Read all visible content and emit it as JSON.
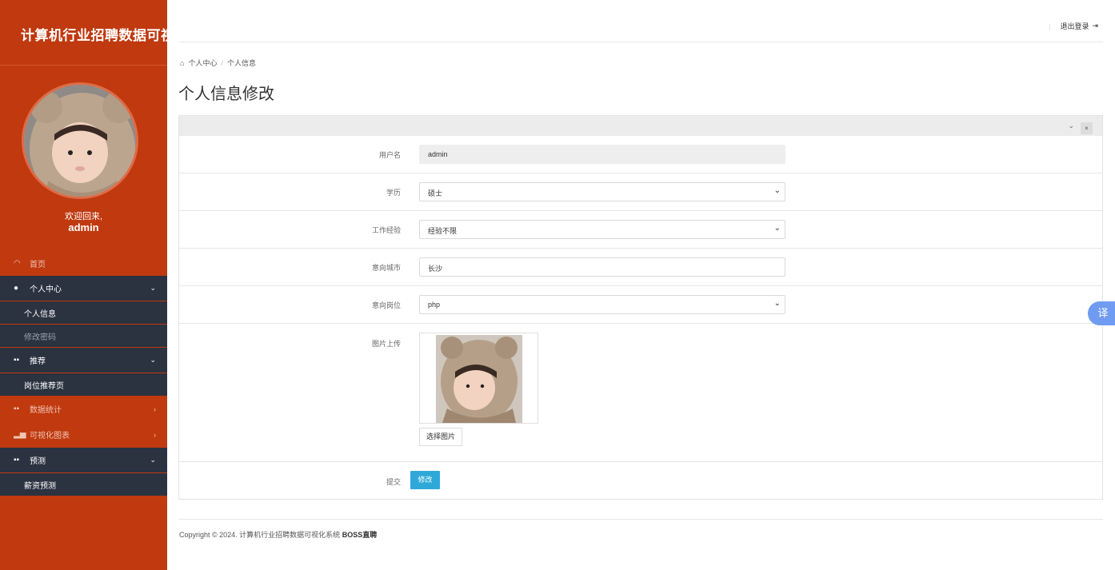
{
  "sidebar": {
    "brand": "计算机行业招聘数据可视化",
    "welcome": "欢迎回来,",
    "username": "admin",
    "items": [
      {
        "label": "首页",
        "icon": "dashboard-icon"
      },
      {
        "label": "个人中心",
        "icon": "user-icon",
        "chevron": "⌄"
      },
      {
        "label": "个人信息"
      },
      {
        "label": "修改密码"
      },
      {
        "label": "推荐",
        "icon": "grid-icon",
        "chevron": "⌄"
      },
      {
        "label": "岗位推荐页"
      },
      {
        "label": "数据统计",
        "icon": "grid-icon",
        "chevron": "›"
      },
      {
        "label": "可视化图表",
        "icon": "bar-chart-icon",
        "chevron": "›"
      },
      {
        "label": "预测",
        "icon": "grid-icon",
        "chevron": "⌄"
      },
      {
        "label": "薪资预测"
      }
    ]
  },
  "header": {
    "logout": "退出登录"
  },
  "breadcrumb": {
    "home": "个人中心",
    "current": "个人信息"
  },
  "page": {
    "title": "个人信息修改"
  },
  "form": {
    "username": {
      "label": "用户名",
      "value": "admin"
    },
    "education": {
      "label": "学历",
      "value": "硕士"
    },
    "experience": {
      "label": "工作经验",
      "value": "经验不限"
    },
    "city": {
      "label": "意向城市",
      "value": "长沙"
    },
    "position": {
      "label": "意向岗位",
      "value": "php"
    },
    "image": {
      "label": "图片上传",
      "button": "选择图片"
    },
    "submit": {
      "label": "提交",
      "button": "修改"
    }
  },
  "footer": {
    "copyright": "Copyright © 2024. 计算机行业招聘数据可视化系统",
    "brand": "BOSS直聘"
  },
  "translate": "译"
}
